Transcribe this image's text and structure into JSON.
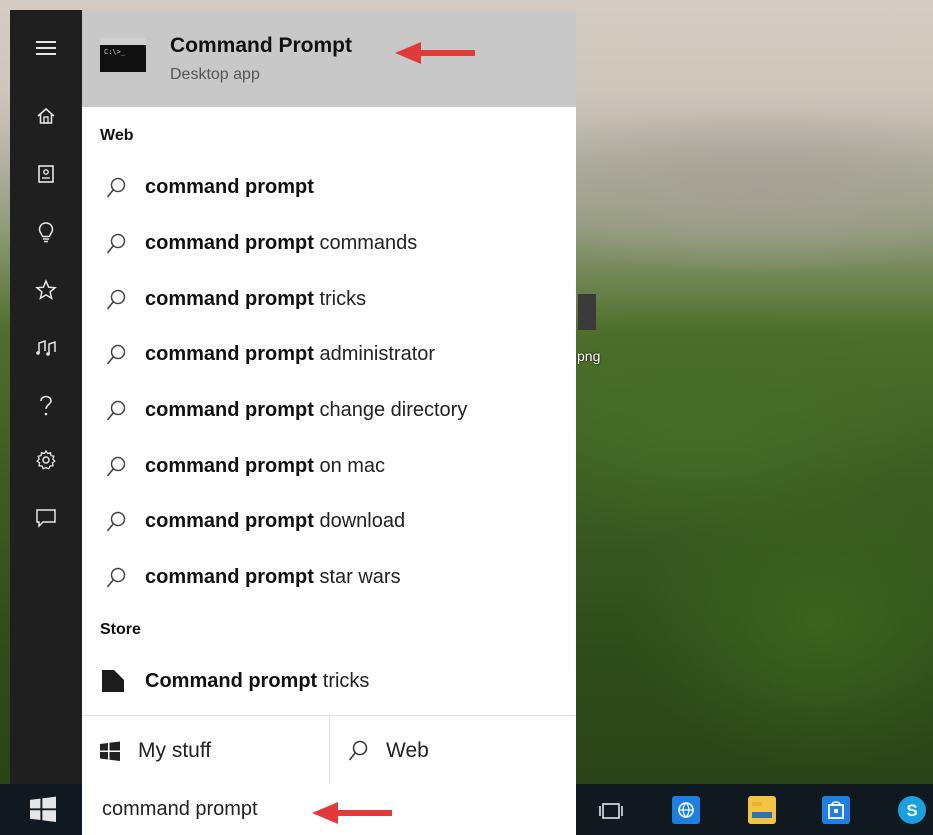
{
  "best_match": {
    "title": "Command Prompt",
    "subtitle": "Desktop app",
    "icon_text": "C:\\>_"
  },
  "sections": {
    "web": "Web",
    "store": "Store"
  },
  "web_results": [
    {
      "bold": "command prompt",
      "rest": ""
    },
    {
      "bold": "command prompt",
      "rest": " commands"
    },
    {
      "bold": "command prompt",
      "rest": " tricks"
    },
    {
      "bold": "command prompt",
      "rest": " administrator"
    },
    {
      "bold": "command prompt",
      "rest": " change directory"
    },
    {
      "bold": "command prompt",
      "rest": " on mac"
    },
    {
      "bold": "command prompt",
      "rest": " download"
    },
    {
      "bold": "command prompt",
      "rest": " star wars"
    }
  ],
  "store_result": {
    "bold": "Command prompt",
    "rest": " tricks"
  },
  "bottom": {
    "my_stuff": "My stuff",
    "web": "Web"
  },
  "search": {
    "value": "command prompt"
  },
  "desktop": {
    "icon_label": "png"
  },
  "colors": {
    "accent_arrow": "#e03a3a",
    "rail_bg": "#1f1f1f",
    "best_match_bg": "#c8c8c8"
  }
}
